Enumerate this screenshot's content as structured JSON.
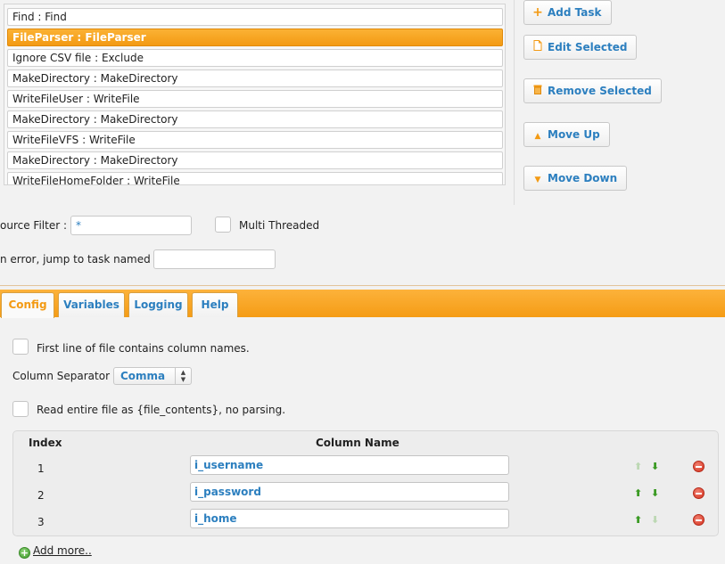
{
  "tasks": [
    "Find : Find",
    "FileParser : FileParser",
    "Ignore CSV file : Exclude",
    "MakeDirectory : MakeDirectory",
    "WriteFileUser : WriteFile",
    "MakeDirectory : MakeDirectory",
    "WriteFileVFS : WriteFile",
    "MakeDirectory : MakeDirectory",
    "WriteFileHomeFolder : WriteFile"
  ],
  "selected_task_index": 1,
  "actions": {
    "add_task": "Add Task",
    "edit_selected": "Edit Selected",
    "remove_selected": "Remove Selected",
    "move_up": "Move Up",
    "move_down": "Move Down"
  },
  "form": {
    "source_filter_label": "ource Filter :",
    "source_filter_value": "*",
    "multi_threaded_label": "Multi Threaded",
    "on_error_label": "n error, jump to task named :",
    "on_error_value": ""
  },
  "tabs": [
    "Config",
    "Variables",
    "Logging",
    "Help"
  ],
  "active_tab": "Config",
  "config": {
    "first_line_label": "First line of file contains column names.",
    "separator_label": "Column Separator :",
    "separator_value": "Comma",
    "entire_file_label": "Read entire file as {file_contents}, no parsing.",
    "table_headers": {
      "index": "Index",
      "column_name": "Column Name"
    },
    "columns": [
      {
        "index": "1",
        "name": "i_username"
      },
      {
        "index": "2",
        "name": "i_password"
      },
      {
        "index": "3",
        "name": "i_home"
      }
    ],
    "add_more_label": "Add more.."
  },
  "colors": {
    "accent": "#f39a13",
    "link": "#2c7fbf",
    "move_arrow": "#3a9a23",
    "delete": "#d6321f"
  }
}
